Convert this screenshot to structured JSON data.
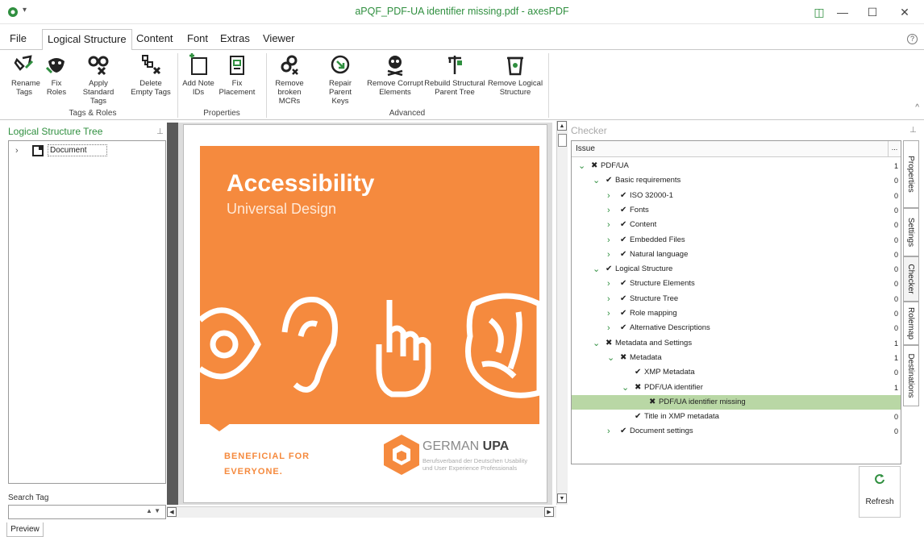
{
  "window": {
    "title": "aPQF_PDF-UA identifier missing.pdf - axesPDF",
    "qa_glyph": "▾",
    "controls": {
      "ribbon_icon": "◫",
      "minimize": "—",
      "maximize": "☐",
      "close": "✕"
    },
    "accent": "#2f8f3f"
  },
  "tabs": [
    {
      "label": "File"
    },
    {
      "label": "Logical Structure"
    },
    {
      "label": "Content"
    },
    {
      "label": "Font"
    },
    {
      "label": "Extras"
    },
    {
      "label": "Viewer"
    }
  ],
  "help_glyph": "?",
  "ribbon": {
    "buttons": [
      {
        "label": "Rename Tags",
        "icon": "rename-tags-icon"
      },
      {
        "label": "Fix Roles",
        "icon": "fix-roles-icon"
      },
      {
        "label": "Apply Standard Tags",
        "icon": "apply-standard-tags-icon"
      },
      {
        "label": "Delete Empty Tags",
        "icon": "delete-empty-tags-icon"
      },
      {
        "label": "Add Note IDs",
        "icon": "add-note-ids-icon"
      },
      {
        "label": "Fix Placement",
        "icon": "fix-placement-icon"
      },
      {
        "label": "Remove broken MCRs",
        "icon": "remove-broken-mcrs-icon"
      },
      {
        "label": "Repair Parent Keys",
        "icon": "repair-parent-keys-icon"
      },
      {
        "label": "Remove Corrupt Elements",
        "icon": "remove-corrupt-elements-icon"
      },
      {
        "label": "Rebuild Structural Parent Tree",
        "icon": "rebuild-parent-tree-icon"
      },
      {
        "label": "Remove Logical Structure",
        "icon": "remove-logical-structure-icon"
      }
    ],
    "groups": [
      {
        "label": "Tags & Roles"
      },
      {
        "label": "Properties"
      },
      {
        "label": "Advanced"
      }
    ],
    "collapse_glyph": "^"
  },
  "left_panel": {
    "title": "Logical Structure Tree",
    "pin_glyph": "⊥",
    "tree": [
      {
        "label": "Document",
        "icon": "document-tag-icon"
      }
    ],
    "search_label": "Search Tag",
    "search_value": "",
    "search_arrows": "▲ ▼"
  },
  "preview": {
    "heading": "Accessibility",
    "subheading": "Universal Design",
    "benefit_line1": "BENEFICIAL FOR",
    "benefit_line2": "EVERYONE.",
    "org_name_light": "GERMAN ",
    "org_name_bold": "UPA",
    "org_desc_line1": "Berufsverband der Deutschen Usability",
    "org_desc_line2": "und User Experience Professionals",
    "orange": "#f58a3e",
    "bottom_tab": "Preview"
  },
  "checker": {
    "title": "Checker",
    "pin_glyph": "⊥",
    "column": "Issue",
    "column_menu": "...",
    "rows": [
      {
        "level": 0,
        "expand": "open",
        "status": "fail",
        "label": "PDF/UA",
        "count": "1"
      },
      {
        "level": 1,
        "expand": "open",
        "status": "pass",
        "label": "Basic requirements",
        "count": "0"
      },
      {
        "level": 2,
        "expand": "closed",
        "status": "pass",
        "label": "ISO 32000-1",
        "count": "0"
      },
      {
        "level": 2,
        "expand": "closed",
        "status": "pass",
        "label": "Fonts",
        "count": "0"
      },
      {
        "level": 2,
        "expand": "closed",
        "status": "pass",
        "label": "Content",
        "count": "0"
      },
      {
        "level": 2,
        "expand": "closed",
        "status": "pass",
        "label": "Embedded Files",
        "count": "0"
      },
      {
        "level": 2,
        "expand": "closed",
        "status": "pass",
        "label": "Natural language",
        "count": "0"
      },
      {
        "level": 1,
        "expand": "open",
        "status": "pass",
        "label": "Logical Structure",
        "count": "0"
      },
      {
        "level": 2,
        "expand": "closed",
        "status": "pass",
        "label": "Structure Elements",
        "count": "0"
      },
      {
        "level": 2,
        "expand": "closed",
        "status": "pass",
        "label": "Structure Tree",
        "count": "0"
      },
      {
        "level": 2,
        "expand": "closed",
        "status": "pass",
        "label": "Role mapping",
        "count": "0"
      },
      {
        "level": 2,
        "expand": "closed",
        "status": "pass",
        "label": "Alternative Descriptions",
        "count": "0"
      },
      {
        "level": 1,
        "expand": "open",
        "status": "fail",
        "label": "Metadata and Settings",
        "count": "1"
      },
      {
        "level": 2,
        "expand": "open",
        "status": "fail",
        "label": "Metadata",
        "count": "1"
      },
      {
        "level": 3,
        "expand": "none",
        "status": "pass",
        "label": "XMP Metadata",
        "count": "0"
      },
      {
        "level": 3,
        "expand": "open",
        "status": "fail",
        "label": "PDF/UA identifier",
        "count": "1"
      },
      {
        "level": 4,
        "expand": "none",
        "status": "fail",
        "label": "PDF/UA identifier missing",
        "count": "",
        "selected": true
      },
      {
        "level": 3,
        "expand": "none",
        "status": "pass",
        "label": "Title in XMP metadata",
        "count": "0"
      },
      {
        "level": 2,
        "expand": "closed",
        "status": "pass",
        "label": "Document settings",
        "count": "0"
      }
    ],
    "refresh_label": "Refresh",
    "side_tabs": [
      {
        "label": "Properties"
      },
      {
        "label": "Settings"
      },
      {
        "label": "Checker"
      },
      {
        "label": "Rolemap"
      },
      {
        "label": "Destinations"
      }
    ],
    "selected_color": "#b9d7a5"
  },
  "scroll": {
    "up": "▲",
    "down": "▼",
    "left": "◀",
    "right": "▶"
  }
}
